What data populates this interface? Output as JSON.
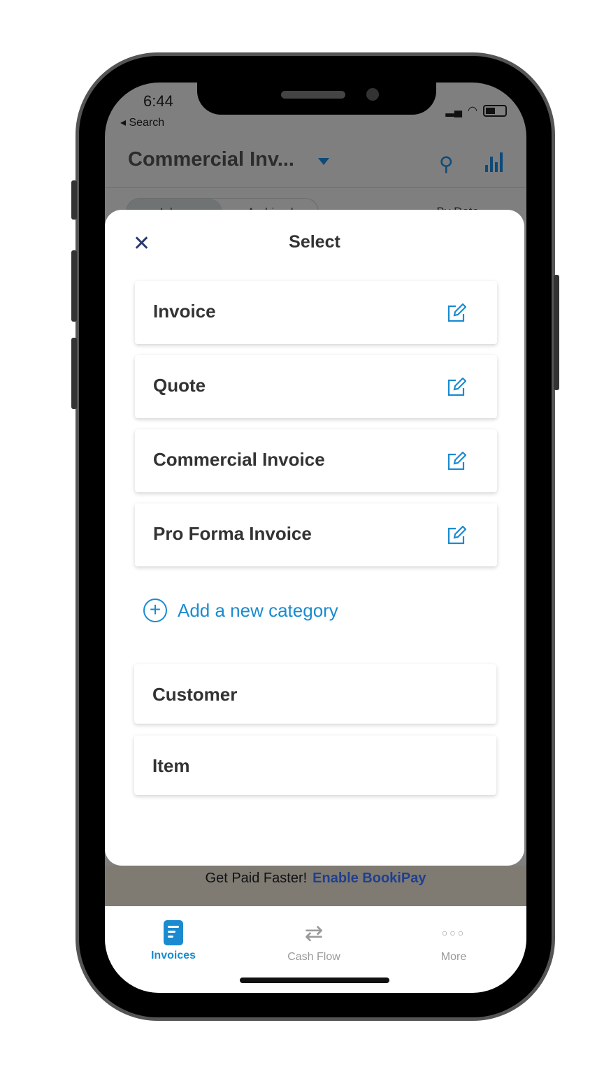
{
  "status_bar": {
    "time": "6:44",
    "back_label": "◂ Search"
  },
  "header": {
    "title": "Commercial Inv...",
    "segments": [
      "Inbox",
      "Archived"
    ],
    "sort_label": "By Date"
  },
  "sheet": {
    "title": "Select",
    "categories": [
      {
        "label": "Invoice"
      },
      {
        "label": "Quote"
      },
      {
        "label": "Commercial Invoice"
      },
      {
        "label": "Pro Forma Invoice"
      }
    ],
    "add_category_label": "Add a new category",
    "other_items": [
      {
        "label": "Customer"
      },
      {
        "label": "Item"
      }
    ]
  },
  "banner": {
    "text": "Get Paid Faster!",
    "link": "Enable BookiPay"
  },
  "tabbar": {
    "items": [
      {
        "label": "Invoices",
        "active": true
      },
      {
        "label": "Cash Flow"
      },
      {
        "label": "More"
      }
    ]
  },
  "colors": {
    "accent": "#1a8bd0",
    "banner_link": "#203f8e",
    "header_icon": "#0e4a78"
  }
}
